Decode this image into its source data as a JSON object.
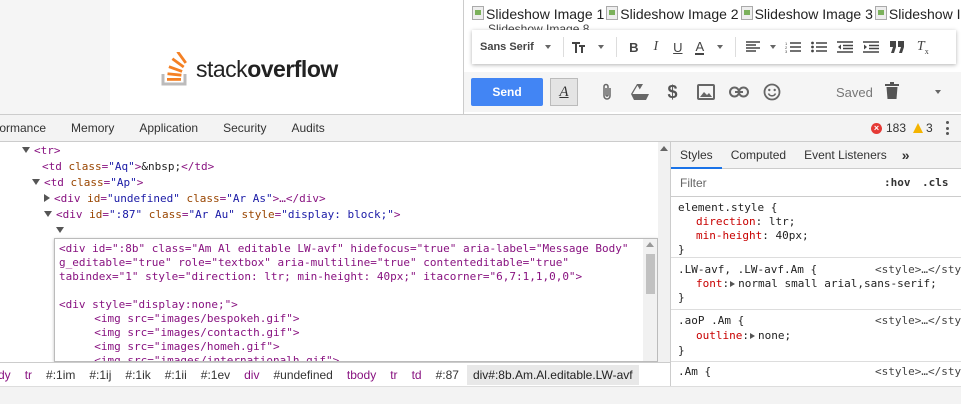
{
  "logo": {
    "text_light": "stack",
    "text_bold": "overflow"
  },
  "compose": {
    "slides": [
      "Slideshow Image 1",
      "Slideshow Image 2",
      "Slideshow Image 3",
      "Slideshow Im"
    ],
    "slides_row2": "Slideshow Image 8",
    "format_bar": {
      "font_family": "Sans Serif"
    },
    "send_label": "Send",
    "format_toggle": "A",
    "saved_label": "Saved"
  },
  "devtools": {
    "tabs": [
      "formance",
      "Memory",
      "Application",
      "Security",
      "Audits"
    ],
    "error_count": "183",
    "warning_count": "3"
  },
  "elements": {
    "lines": {
      "l1_tag": "<tr>",
      "l2_a": "<td ",
      "l2_attr": "class",
      "l2_val": "\"Aq\"",
      "l2_b": ">",
      "l2_text": "&nbsp;",
      "l2_c": "</td>",
      "l3_a": "<td ",
      "l3_attr": "class",
      "l3_val": "\"Ap\"",
      "l3_b": ">",
      "l4_a": "<div ",
      "l4_attr1": "id",
      "l4_val1": "\"undefined\"",
      "l4_attr2": "class",
      "l4_val2": "\"Ar As\"",
      "l4_b": ">…</div>",
      "l5_a": "<div ",
      "l5_attr1": "id",
      "l5_val1": "\":87\"",
      "l5_attr2": "class",
      "l5_val2": "\"Ar Au\"",
      "l5_attr3": "style",
      "l5_val3": "\"display: block;\"",
      "l5_b": ">"
    },
    "editor": {
      "e1": "<div id=\":8b\" class=\"Am Al editable LW-avf\" hidefocus=\"true\" aria-label=\"Message Body\"",
      "e2": "g_editable=\"true\" role=\"textbox\" aria-multiline=\"true\" contenteditable=\"true\"",
      "e3": "tabindex=\"1\" style=\"direction: ltr; min-height: 40px;\" itacorner=\"6,7:1,1,0,0\">",
      "e4": "<div style=\"display:none;\">",
      "e5": "  <img src=\"images/bespokeh.gif\">",
      "e6": "  <img src=\"images/contacth.gif\">",
      "e7": "  <img src=\"images/homeh.gif\">",
      "e8": "  <img src=\"images/internationalh.gif\">"
    }
  },
  "breadcrumbs": [
    {
      "label": "dy",
      "kind": "tag"
    },
    {
      "label": "tr",
      "kind": "tag"
    },
    {
      "label": "#:1im",
      "kind": "plain"
    },
    {
      "label": "#:1ij",
      "kind": "plain"
    },
    {
      "label": "#:1ik",
      "kind": "plain"
    },
    {
      "label": "#:1ii",
      "kind": "plain"
    },
    {
      "label": "#:1ev",
      "kind": "plain"
    },
    {
      "label": "div",
      "kind": "tag"
    },
    {
      "label": "#undefined",
      "kind": "plain"
    },
    {
      "label": "tbody",
      "kind": "tag"
    },
    {
      "label": "tr",
      "kind": "tag"
    },
    {
      "label": "td",
      "kind": "tag"
    },
    {
      "label": "#:87",
      "kind": "plain"
    },
    {
      "label": "div#:8b.Am.Al.editable.LW-avf",
      "kind": "selected"
    }
  ],
  "styles_pane": {
    "tabs": [
      "Styles",
      "Computed",
      "Event Listeners"
    ],
    "more": "»",
    "filter_placeholder": "Filter",
    "hov": ":hov",
    "cls": ".cls",
    "rules": {
      "r1_sel": "element.style {",
      "r1_p1": "direction",
      "r1_v1": "ltr;",
      "r1_p2": "min-height",
      "r1_v2": "40px;",
      "r1_close": "}",
      "r2_sel": ".LW-avf, .LW-avf.Am {",
      "r2_src": "<style>…</sty",
      "r2_p1": "font",
      "r2_v1": "normal small arial,sans-serif;",
      "r2_close": "}",
      "r3_sel": ".aoP .Am {",
      "r3_src": "<style>…</sty",
      "r3_p1": "outline",
      "r3_v1": "none;",
      "r3_close": "}",
      "r4_sel": ".Am {",
      "r4_src": "<style>…</sty"
    }
  }
}
